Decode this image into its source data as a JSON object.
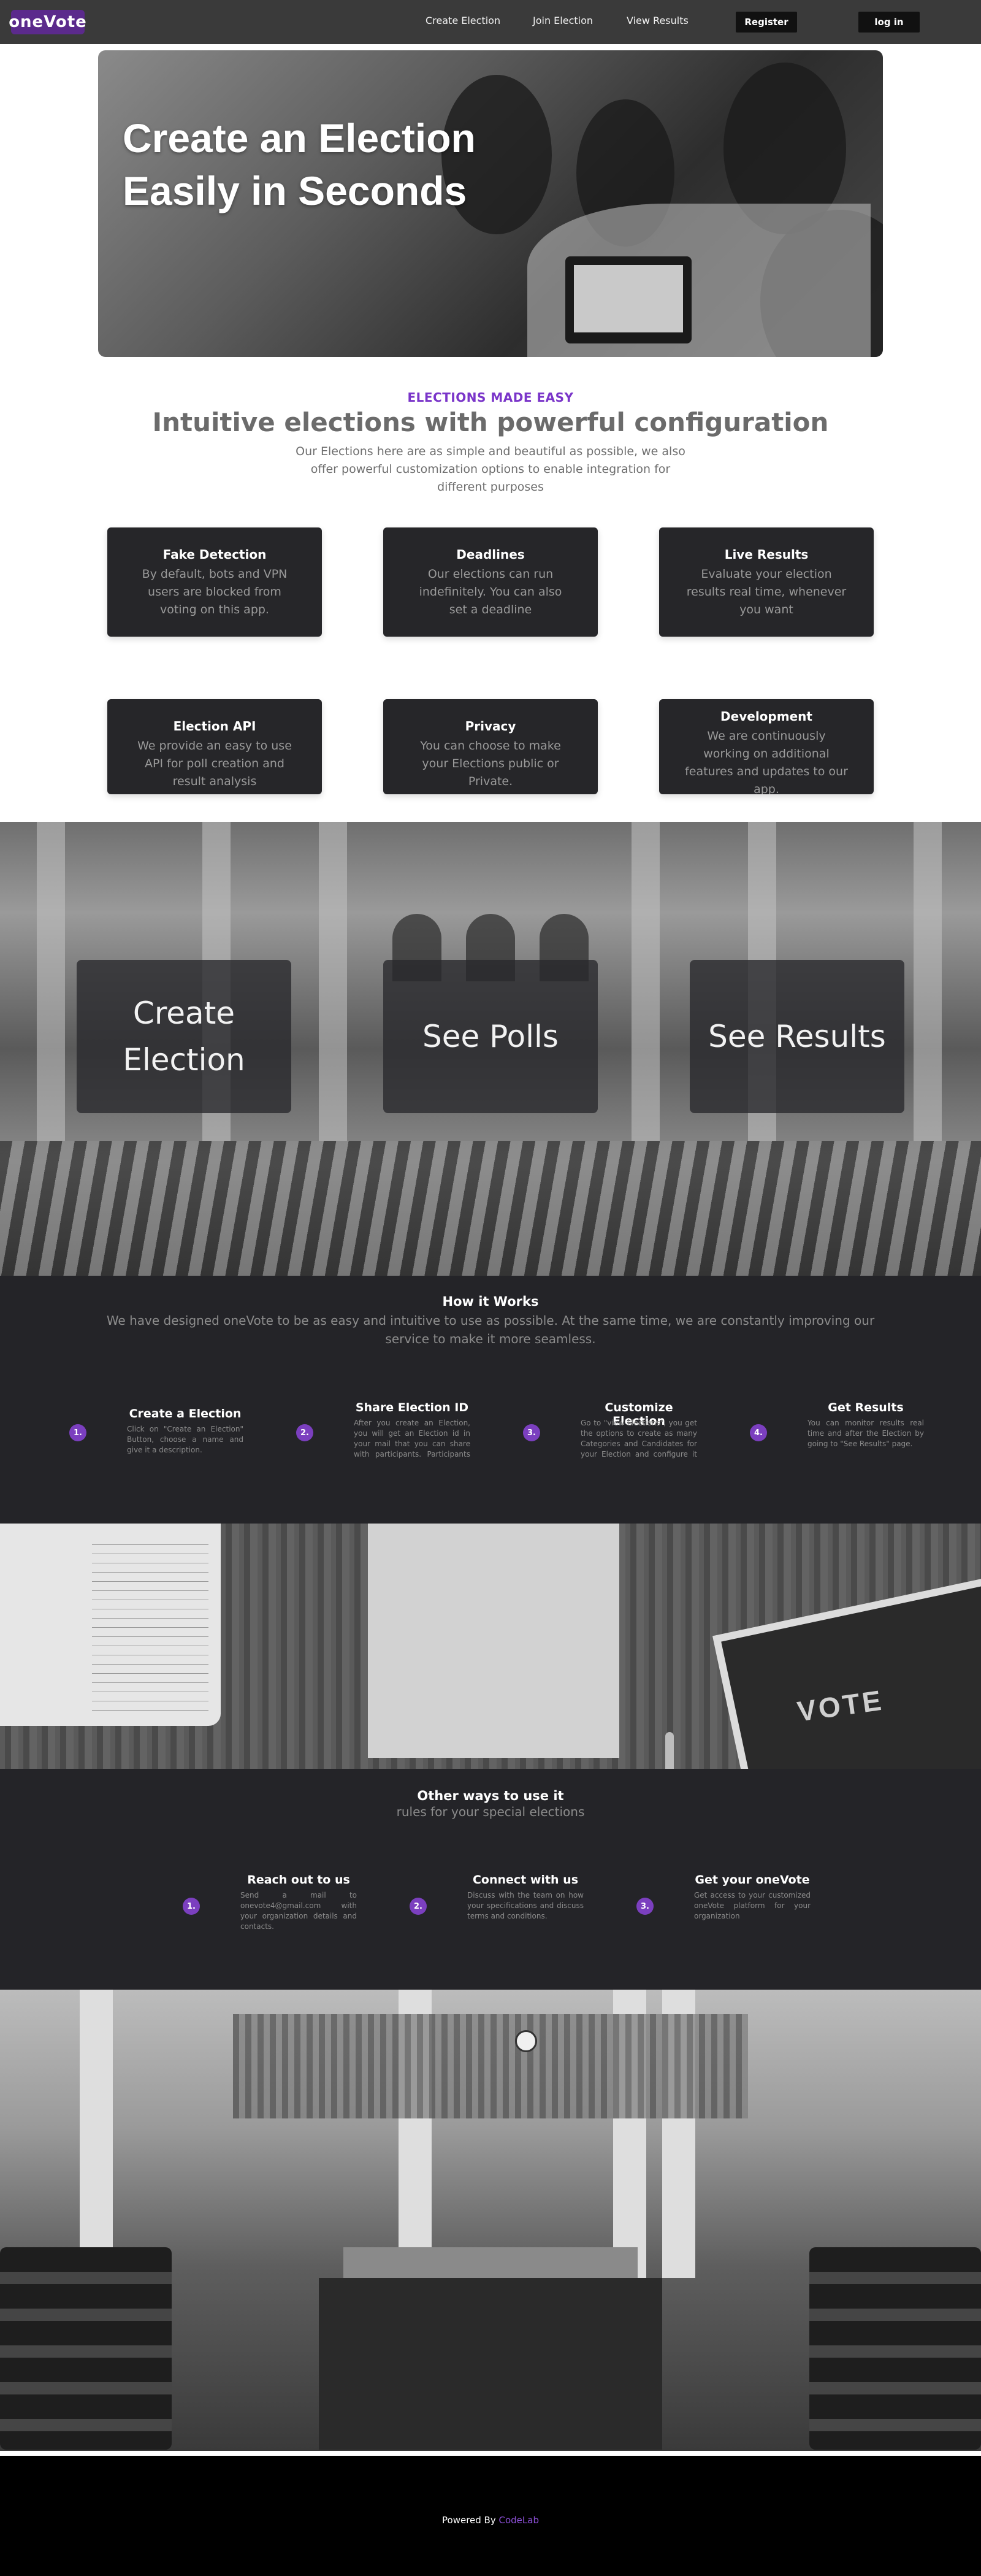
{
  "nav": {
    "logo": "oneVote",
    "links": [
      "Create Election",
      "Join Election",
      "View Results"
    ],
    "register_label": "Register",
    "login_label": "log in"
  },
  "hero": {
    "title_line1": "Create an Election",
    "title_line2": "Easily in Seconds"
  },
  "intro": {
    "eyebrow": "ELECTIONS MADE EASY",
    "headline": "Intuitive elections with powerful configuration",
    "subline": "Our Elections here are as simple and beautiful as possible, we also offer powerful customization options to enable integration for different purposes"
  },
  "features": [
    {
      "title": "Fake Detection",
      "desc": "By default, bots and VPN users are blocked from voting on this app."
    },
    {
      "title": "Deadlines",
      "desc": "Our elections can run indefinitely. You can also set a deadline"
    },
    {
      "title": "Live Results",
      "desc": "Evaluate your election results real time, whenever you want"
    },
    {
      "title": "Election API",
      "desc": "We provide an easy to use API for poll creation and result analysis"
    },
    {
      "title": "Privacy",
      "desc": "You can choose to make your Elections public or Private."
    },
    {
      "title": "Development",
      "desc": "We are continuously working on additional features and updates to our app."
    }
  ],
  "actions": {
    "create": "Create Election",
    "polls": "See Polls",
    "results": "See Results"
  },
  "how": {
    "title": "How it Works",
    "subtitle": "We have designed oneVote to be as easy and intuitive to use as possible. At the same time, we are constantly improving our service to make it more seamless.",
    "steps": [
      {
        "num": "1.",
        "title": "Create a Election",
        "desc": "Click on \"Create an Election\" Button, choose a name and give it a description."
      },
      {
        "num": "2.",
        "title": "Share Election ID",
        "desc": "After you create an Election, you will get an Election id in your mail that you can share with participants. Participants can then join."
      },
      {
        "num": "3.",
        "title": "Customize Election",
        "desc": "Go to \"view Elections\", you get the options to create as many Categories and Candidates for your Election and configure it as you want."
      },
      {
        "num": "4.",
        "title": "Get Results",
        "desc": "You can monitor results real time and after the Election by going to \"See Results\" page."
      }
    ]
  },
  "other": {
    "title": "Other ways to use it",
    "subtitle": "rules for your special elections",
    "items": [
      {
        "num": "1.",
        "title": "Reach out to us",
        "desc": "Send a mail to onevote4@gmail.com with your organization details and contacts."
      },
      {
        "num": "2.",
        "title": "Connect with us",
        "desc": "Discuss with the team on how your specifications and discuss terms and conditions."
      },
      {
        "num": "3.",
        "title": "Get your oneVote",
        "desc": "Get access to your customized oneVote platform for your organization"
      }
    ]
  },
  "vote_image_text": "VOTE",
  "footer": {
    "prefix": "Powered By ",
    "brand": "CodeLab"
  },
  "colors": {
    "accent": "#7b3fbf",
    "dark_section": "#242428",
    "card": "#262629"
  }
}
